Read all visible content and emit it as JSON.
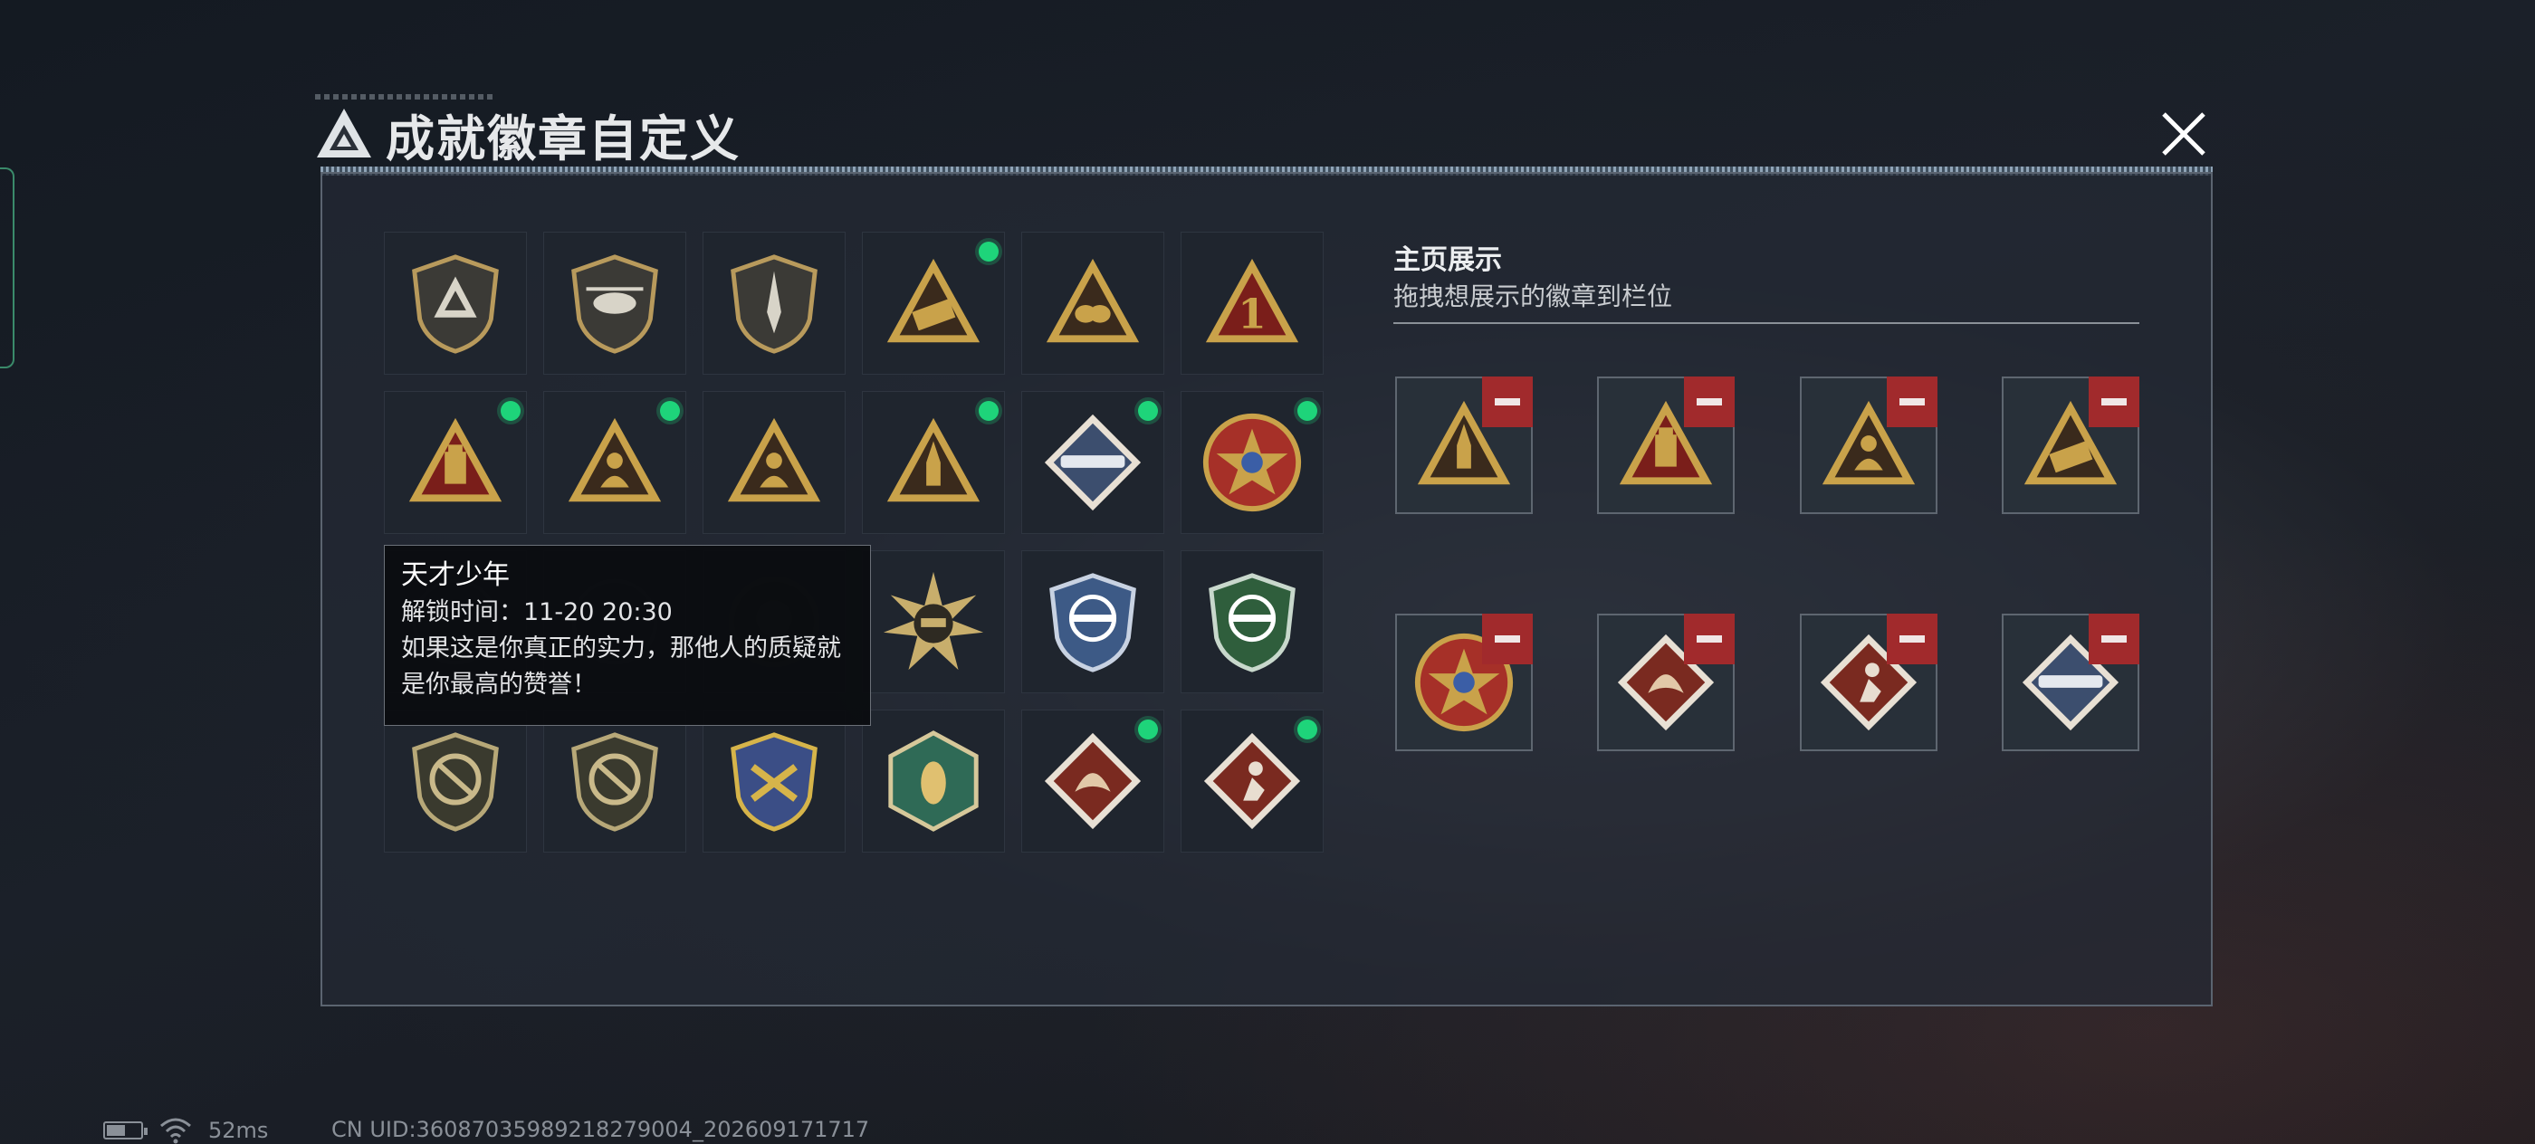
{
  "window": {
    "title": "成就徽章自定义",
    "close_icon": "close-x-icon"
  },
  "colors": {
    "new_dot": "#1ed47a",
    "remove": "#a12a2c",
    "gold": "#c9a24a",
    "red": "#7a1e1a"
  },
  "badges": [
    {
      "icon": "tripod-logo-shield-icon",
      "new": false
    },
    {
      "icon": "helicopter-shield-icon",
      "new": false
    },
    {
      "icon": "dagger-shield-icon",
      "new": false
    },
    {
      "icon": "missile-launcher-triangle-icon",
      "new": true
    },
    {
      "icon": "egg-nest-triangle-icon",
      "new": false
    },
    {
      "icon": "number-one-triangle-icon",
      "new": false
    },
    {
      "icon": "usb-drive-triangle-icon",
      "new": true
    },
    {
      "icon": "seated-figure-triangle-icon",
      "new": true
    },
    {
      "icon": "soldiers-triangle-icon",
      "new": false
    },
    {
      "icon": "rocket-triangle-icon",
      "new": true
    },
    {
      "icon": "bazooka-diamond-icon",
      "new": true
    },
    {
      "icon": "star-medallion-icon",
      "new": true
    },
    {
      "icon": "hidden-badge-icon",
      "new": false
    },
    {
      "icon": "hidden-badge-icon",
      "new": false
    },
    {
      "icon": "skull-roundel-icon",
      "new": false
    },
    {
      "icon": "tank-sunburst-icon",
      "new": false
    },
    {
      "icon": "crosshair-rifle-blue-shield-icon",
      "new": false
    },
    {
      "icon": "crosshair-rifle-green-shield-icon",
      "new": false
    },
    {
      "icon": "rifle-prohibited-shield-icon",
      "new": false
    },
    {
      "icon": "smg-prohibited-shield-icon",
      "new": false
    },
    {
      "icon": "crossed-rifles-gold-shield-icon",
      "new": false
    },
    {
      "icon": "wasp-hexagon-icon",
      "new": false
    },
    {
      "icon": "dragon-diamond-icon",
      "new": true
    },
    {
      "icon": "runner-diamond-icon",
      "new": true
    }
  ],
  "tooltip": {
    "title": "天才少年",
    "unlock_time": "解锁时间：11-20 20:30",
    "desc_line1": "如果这是你真正的实力，那他人的质疑就",
    "desc_line2": "是你最高的赞誉！"
  },
  "showcase": {
    "title": "主页展示",
    "subtitle": "拖拽想展示的徽章到栏位",
    "slots": [
      {
        "icon": "rocket-triangle-icon"
      },
      {
        "icon": "usb-drive-triangle-icon"
      },
      {
        "icon": "seated-figure-triangle-icon"
      },
      {
        "icon": "missile-launcher-triangle-icon"
      },
      {
        "icon": "star-medallion-icon"
      },
      {
        "icon": "dragon-diamond-icon"
      },
      {
        "icon": "runner-diamond-icon"
      },
      {
        "icon": "bazooka-diamond-icon"
      }
    ]
  },
  "status_bar": {
    "ping": "52ms",
    "uid": "CN UID:3608703598921827900​4_202609171717"
  }
}
